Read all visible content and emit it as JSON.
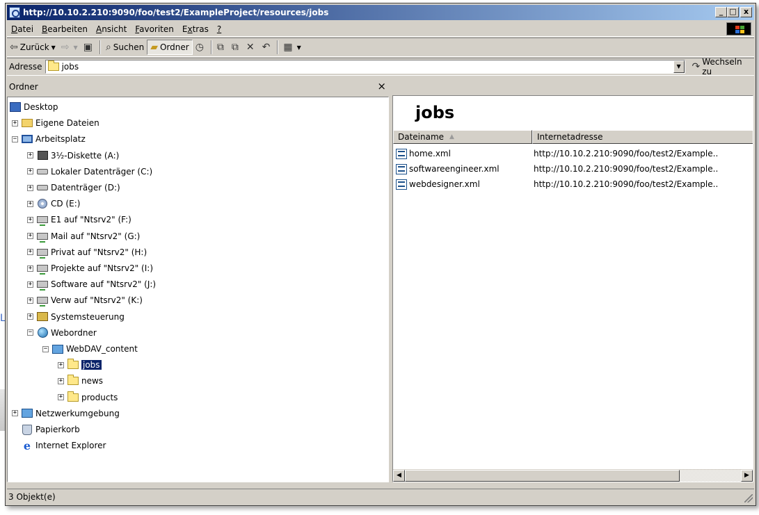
{
  "window": {
    "title": "http://10.10.2.210:9090/foo/test2/ExampleProject/resources/jobs",
    "controls": [
      "_",
      "□",
      "x"
    ]
  },
  "menu": [
    {
      "label": "Datei",
      "underline": "D",
      "rest": "atei"
    },
    {
      "label": "Bearbeiten",
      "underline": "B",
      "rest": "earbeiten"
    },
    {
      "label": "Ansicht",
      "underline": "A",
      "rest": "nsicht"
    },
    {
      "label": "Favoriten",
      "underline": "F",
      "rest": "avoriten"
    },
    {
      "label": "Extras",
      "pre": "E",
      "underline": "x",
      "rest": "tras"
    },
    {
      "label": "?",
      "underline": "?",
      "rest": ""
    }
  ],
  "toolbar": {
    "back": "Zurück",
    "search": "Suchen",
    "folders": "Ordner"
  },
  "address": {
    "label": "Adresse",
    "value": "jobs",
    "go": "Wechseln zu"
  },
  "folders_pane": {
    "header": "Ordner",
    "close": "×",
    "tree": [
      {
        "label": "Desktop",
        "icon": "desktop-icon",
        "level": 0,
        "expander": "none"
      },
      {
        "label": "Eigene Dateien",
        "icon": "documents-icon",
        "level": 1,
        "expander": "plus"
      },
      {
        "label": "Arbeitsplatz",
        "icon": "computer-icon",
        "level": 1,
        "expander": "minus"
      },
      {
        "label": "3½-Diskette (A:)",
        "icon": "floppy-icon",
        "level": 2,
        "expander": "plus"
      },
      {
        "label": "Lokaler Datenträger (C:)",
        "icon": "drive-icon",
        "level": 2,
        "expander": "plus"
      },
      {
        "label": "Datenträger (D:)",
        "icon": "drive-icon",
        "level": 2,
        "expander": "plus"
      },
      {
        "label": "CD (E:)",
        "icon": "cd-icon",
        "level": 2,
        "expander": "plus"
      },
      {
        "label": "E1 auf \"Ntsrv2\" (F:)",
        "icon": "network-drive-icon",
        "level": 2,
        "expander": "plus"
      },
      {
        "label": "Mail auf \"Ntsrv2\" (G:)",
        "icon": "network-drive-icon",
        "level": 2,
        "expander": "plus"
      },
      {
        "label": "Privat auf \"Ntsrv2\" (H:)",
        "icon": "network-drive-icon",
        "level": 2,
        "expander": "plus"
      },
      {
        "label": "Projekte auf \"Ntsrv2\" (I:)",
        "icon": "network-drive-icon",
        "level": 2,
        "expander": "plus"
      },
      {
        "label": "Software auf \"Ntsrv2\" (J:)",
        "icon": "network-drive-icon",
        "level": 2,
        "expander": "plus"
      },
      {
        "label": "Verw auf \"Ntsrv2\" (K:)",
        "icon": "network-drive-icon",
        "level": 2,
        "expander": "plus"
      },
      {
        "label": "Systemsteuerung",
        "icon": "control-panel-icon",
        "level": 2,
        "expander": "plus"
      },
      {
        "label": "Webordner",
        "icon": "web-folders-icon",
        "level": 2,
        "expander": "minus"
      },
      {
        "label": "WebDAV_content",
        "icon": "web-folder-icon",
        "level": 3,
        "expander": "minus"
      },
      {
        "label": "jobs",
        "icon": "folder-icon",
        "level": 4,
        "expander": "plus",
        "selected": true
      },
      {
        "label": "news",
        "icon": "folder-icon",
        "level": 4,
        "expander": "plus"
      },
      {
        "label": "products",
        "icon": "folder-icon",
        "level": 4,
        "expander": "plus"
      },
      {
        "label": "Netzwerkumgebung",
        "icon": "network-places-icon",
        "level": 1,
        "expander": "plus"
      },
      {
        "label": "Papierkorb",
        "icon": "recycle-bin-icon",
        "level": 1,
        "expander": "none"
      },
      {
        "label": "Internet Explorer",
        "icon": "ie-icon",
        "level": 1,
        "expander": "none"
      }
    ]
  },
  "list_pane": {
    "title": "jobs",
    "columns": [
      "Dateiname",
      "Internetadresse"
    ],
    "rows": [
      {
        "name": "home.xml",
        "url": "http://10.10.2.210:9090/foo/test2/Example.."
      },
      {
        "name": "softwareengineer.xml",
        "url": "http://10.10.2.210:9090/foo/test2/Example.."
      },
      {
        "name": "webdesigner.xml",
        "url": "http://10.10.2.210:9090/foo/test2/Example.."
      }
    ]
  },
  "status": {
    "text": "3 Objekt(e)"
  }
}
